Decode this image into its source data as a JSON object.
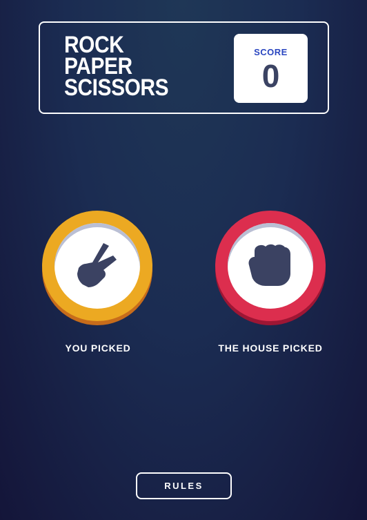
{
  "header": {
    "title_lines": [
      "ROCK",
      "PAPER",
      "SCISSORS"
    ],
    "score_label": "SCORE",
    "score_value": "0"
  },
  "picks": {
    "player": {
      "label": "YOU PICKED",
      "choice_icon": "scissors-icon",
      "ring_color": "#eca922"
    },
    "house": {
      "label": "THE HOUSE PICKED",
      "choice_icon": "rock-icon",
      "ring_color": "#dc2e4e"
    }
  },
  "footer": {
    "rules_label": "RULES"
  }
}
